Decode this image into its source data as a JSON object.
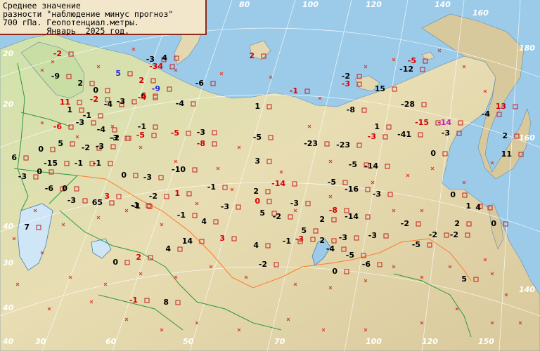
{
  "legend": {
    "line1": "Среднее значение",
    "line2": "разности \"наблюдение минус прогноз\"",
    "line3": "700 гПа. Геопотенциал.метры.",
    "line4": "         Январь  2025 год."
  },
  "grid_labels": [
    "60",
    "80",
    "100",
    "120",
    "140",
    "160",
    "180",
    "160",
    "140",
    "20",
    "40",
    "50",
    "60",
    "100",
    "120",
    "150",
    "30",
    "40",
    "70",
    "40",
    "30",
    "20"
  ],
  "colors": {
    "sea": "#9ccbe9",
    "land": "#e7dcb0",
    "lowland": "#b6d9a0",
    "station_box": "#c41e1e",
    "missing_cross": "#d13a2a",
    "value_normal": "#000000",
    "value_alert": "#d60000",
    "value_extreme": "#2a2ad6",
    "value_magenta": "#c21ec2"
  },
  "stations": [
    {
      "v": "-2",
      "c": "red"
    },
    {
      "v": "-9",
      "c": "black"
    },
    {
      "v": "2",
      "c": "black"
    },
    {
      "v": "0",
      "c": "black"
    },
    {
      "v": "-3",
      "c": "black"
    },
    {
      "v": "4",
      "c": "black"
    },
    {
      "v": "-34",
      "c": "red"
    },
    {
      "v": "5",
      "c": "blue"
    },
    {
      "v": "2",
      "c": "red"
    },
    {
      "v": "-9",
      "c": "blue"
    },
    {
      "v": "-6",
      "c": "black"
    },
    {
      "v": "2",
      "c": "red"
    },
    {
      "v": "-1",
      "c": "red"
    },
    {
      "v": "-2",
      "c": "black"
    },
    {
      "v": "-3",
      "c": "red"
    },
    {
      "v": "-5",
      "c": "red"
    },
    {
      "v": "-12",
      "c": "black"
    },
    {
      "v": "15",
      "c": "black"
    },
    {
      "v": "11",
      "c": "red"
    },
    {
      "v": "-2",
      "c": "red"
    },
    {
      "v": "-4",
      "c": "black"
    },
    {
      "v": "-3",
      "c": "black"
    },
    {
      "v": "6",
      "c": "black"
    },
    {
      "v": "-4",
      "c": "red"
    },
    {
      "v": "-4",
      "c": "black"
    },
    {
      "v": "1",
      "c": "black"
    },
    {
      "v": "-8",
      "c": "black"
    },
    {
      "v": "-28",
      "c": "black"
    },
    {
      "v": "13",
      "c": "red"
    },
    {
      "v": "-1",
      "c": "black"
    },
    {
      "v": "1",
      "c": "black"
    },
    {
      "v": "-6",
      "c": "red"
    },
    {
      "v": "-3",
      "c": "black"
    },
    {
      "v": "-4",
      "c": "black"
    },
    {
      "v": "-1",
      "c": "black"
    },
    {
      "v": "-5",
      "c": "red"
    },
    {
      "v": "-3",
      "c": "black"
    },
    {
      "v": "-15",
      "c": "red"
    },
    {
      "v": "-14",
      "c": "magenta"
    },
    {
      "v": "-4",
      "c": "black"
    },
    {
      "v": "5",
      "c": "black"
    },
    {
      "v": "-2",
      "c": "black"
    },
    {
      "v": "-2",
      "c": "black"
    },
    {
      "v": "-5",
      "c": "red"
    },
    {
      "v": "-3",
      "c": "black"
    },
    {
      "v": "-8",
      "c": "red"
    },
    {
      "v": "-5",
      "c": "black"
    },
    {
      "v": "1",
      "c": "black"
    },
    {
      "v": "-3",
      "c": "red"
    },
    {
      "v": "-41",
      "c": "black"
    },
    {
      "v": "-3",
      "c": "black"
    },
    {
      "v": "2",
      "c": "black"
    },
    {
      "v": "0",
      "c": "black"
    },
    {
      "v": "-3",
      "c": "black"
    },
    {
      "v": "-15",
      "c": "black"
    },
    {
      "v": "-1",
      "c": "black"
    },
    {
      "v": "-1",
      "c": "black"
    },
    {
      "v": "-23",
      "c": "black"
    },
    {
      "v": "-23",
      "c": "black"
    },
    {
      "v": "0",
      "c": "black"
    },
    {
      "v": "11",
      "c": "black"
    },
    {
      "v": "6",
      "c": "black"
    },
    {
      "v": "-10",
      "c": "black"
    },
    {
      "v": "3",
      "c": "black"
    },
    {
      "v": "-5",
      "c": "black"
    },
    {
      "v": "-14",
      "c": "black"
    },
    {
      "v": "-3",
      "c": "black"
    },
    {
      "v": "0",
      "c": "black"
    },
    {
      "v": "0",
      "c": "black"
    },
    {
      "v": "-3",
      "c": "black"
    },
    {
      "v": "-14",
      "c": "red"
    },
    {
      "v": "-5",
      "c": "black"
    },
    {
      "v": "-16",
      "c": "black"
    },
    {
      "v": "-3",
      "c": "black"
    },
    {
      "v": "-6",
      "c": "black"
    },
    {
      "v": "0",
      "c": "black"
    },
    {
      "v": "-3",
      "c": "black"
    },
    {
      "v": "1",
      "c": "red"
    },
    {
      "v": "-1",
      "c": "black"
    },
    {
      "v": "2",
      "c": "black"
    },
    {
      "v": "0",
      "c": "red"
    },
    {
      "v": "-3",
      "c": "black"
    },
    {
      "v": "-2",
      "c": "black"
    },
    {
      "v": "-1",
      "c": "black"
    },
    {
      "v": "-3",
      "c": "black"
    },
    {
      "v": "2",
      "c": "black"
    },
    {
      "v": "-8",
      "c": "red"
    },
    {
      "v": "1",
      "c": "black"
    },
    {
      "v": "4",
      "c": "black"
    },
    {
      "v": "65",
      "c": "black"
    },
    {
      "v": "3",
      "c": "red"
    },
    {
      "v": "-1",
      "c": "black"
    },
    {
      "v": "-1",
      "c": "black"
    },
    {
      "v": "5",
      "c": "black"
    },
    {
      "v": "-2",
      "c": "black"
    },
    {
      "v": "-14",
      "c": "black"
    },
    {
      "v": "0",
      "c": "black"
    },
    {
      "v": "7",
      "c": "black"
    },
    {
      "v": "0",
      "c": "black"
    },
    {
      "v": "4",
      "c": "black"
    },
    {
      "v": "-2",
      "c": "black"
    },
    {
      "v": "5",
      "c": "black"
    },
    {
      "v": "2",
      "c": "black"
    },
    {
      "v": "3",
      "c": "red"
    },
    {
      "v": "14",
      "c": "black"
    },
    {
      "v": "4",
      "c": "black"
    },
    {
      "v": "-1",
      "c": "black"
    },
    {
      "v": "-3",
      "c": "red"
    },
    {
      "v": "-3",
      "c": "black"
    },
    {
      "v": "-3",
      "c": "black"
    },
    {
      "v": "-2",
      "c": "black"
    },
    {
      "v": "-2",
      "c": "black"
    },
    {
      "v": "4",
      "c": "black"
    },
    {
      "v": "2",
      "c": "black"
    },
    {
      "v": "-5",
      "c": "black"
    },
    {
      "v": "-4",
      "c": "black"
    },
    {
      "v": "-5",
      "c": "black"
    },
    {
      "v": "-6",
      "c": "black"
    },
    {
      "v": "0",
      "c": "black"
    },
    {
      "v": "2",
      "c": "red"
    },
    {
      "v": "-2",
      "c": "black"
    },
    {
      "v": "0",
      "c": "black"
    },
    {
      "v": "5",
      "c": "black"
    },
    {
      "v": "-1",
      "c": "red"
    },
    {
      "v": "8",
      "c": "black"
    }
  ]
}
